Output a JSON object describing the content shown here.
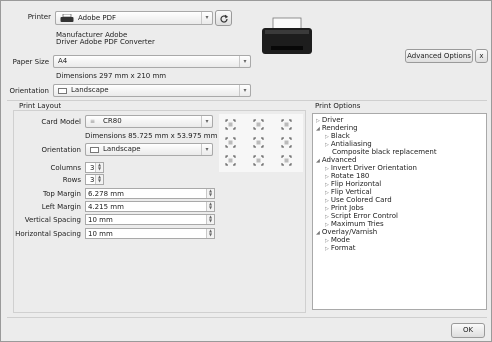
{
  "printer": {
    "label": "Printer",
    "value": "Adobe PDF",
    "manufacturer": "Manufacturer Adobe",
    "driver": "Driver Adobe PDF Converter",
    "icon": "printer-icon",
    "refresh_icon": "refresh-icon"
  },
  "paper_size": {
    "label": "Paper Size",
    "value": "A4",
    "dimensions": "Dimensions 297 mm x 210 mm"
  },
  "orientation": {
    "label": "Orientation",
    "value": "Landscape"
  },
  "advanced_options_label": "Advanced Options",
  "close_label": "x",
  "print_layout": {
    "title": "Print Layout",
    "card_model_label": "Card Model",
    "card_model_value": "CR80",
    "card_dimensions": "Dimensions 85.725 mm x 53.975 mm",
    "orientation_label": "Orientation",
    "orientation_value": "Landscape",
    "columns_label": "Columns",
    "columns_value": "3",
    "rows_label": "Rows",
    "rows_value": "3",
    "top_margin_label": "Top Margin",
    "top_margin_value": "6.278 mm",
    "left_margin_label": "Left Margin",
    "left_margin_value": "4.215 mm",
    "vertical_spacing_label": "Vertical Spacing",
    "vertical_spacing_value": "10 mm",
    "horizontal_spacing_label": "Horizontal Spacing",
    "horizontal_spacing_value": "10 mm",
    "preview_cards": 9
  },
  "print_options": {
    "title": "Print Options",
    "items": [
      {
        "label": "Driver",
        "level": 0,
        "state": "collapsed"
      },
      {
        "label": "Rendering",
        "level": 0,
        "state": "expanded"
      },
      {
        "label": "Black",
        "level": 1,
        "state": "collapsed"
      },
      {
        "label": "Antialiasing",
        "level": 1,
        "state": "collapsed"
      },
      {
        "label": "Composite black replacement",
        "level": 1,
        "state": "leaf"
      },
      {
        "label": "Advanced",
        "level": 0,
        "state": "expanded"
      },
      {
        "label": "Invert Driver Orientation",
        "level": 1,
        "state": "collapsed"
      },
      {
        "label": "Rotate 180",
        "level": 1,
        "state": "collapsed"
      },
      {
        "label": "Flip Horizontal",
        "level": 1,
        "state": "collapsed"
      },
      {
        "label": "Flip Vertical",
        "level": 1,
        "state": "collapsed"
      },
      {
        "label": "Use Colored Card",
        "level": 1,
        "state": "collapsed"
      },
      {
        "label": "Print Jobs",
        "level": 1,
        "state": "collapsed"
      },
      {
        "label": "Script Error Control",
        "level": 1,
        "state": "collapsed"
      },
      {
        "label": "Maximum Tries",
        "level": 1,
        "state": "collapsed"
      },
      {
        "label": "Overlay/Varnish",
        "level": 0,
        "state": "expanded"
      },
      {
        "label": "Mode",
        "level": 1,
        "state": "collapsed"
      },
      {
        "label": "Format",
        "level": 1,
        "state": "collapsed"
      }
    ]
  },
  "ok_label": "OK"
}
